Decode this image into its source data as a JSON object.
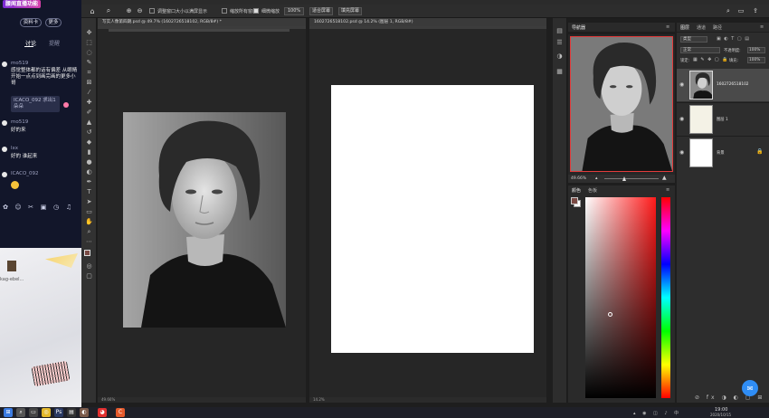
{
  "chat": {
    "banner": "腰闻直播功能",
    "buttons": [
      "资料卡",
      "更多"
    ],
    "tabs": [
      "讨论",
      "提醒"
    ],
    "messages": [
      {
        "name": "mo519",
        "text": "感觉整体都的话有偏差 从眼睛开始一点点到画完画的更多小哥"
      },
      {
        "name": "",
        "text": "ICACO_092 求出1朵朵"
      },
      {
        "name": "mo519",
        "text": "好的来"
      },
      {
        "name": "lxx",
        "text": "好的 谁起来"
      },
      {
        "name": "ICACO_092",
        "text": ""
      }
    ],
    "bottom_label": "kag-ebel..."
  },
  "options_bar": {
    "check1": "调整窗口大小以满屏显示",
    "check2": "缩放所有窗口",
    "check3": "细微缩放",
    "zoom": "100%",
    "btn1": "适合屏幕",
    "btn2": "填充屏幕"
  },
  "documents": [
    {
      "tab": "写实人像第四期.psd @ 49.7% (1602726518102, RGB/8#) *",
      "status": "49.66%"
    },
    {
      "tab": "1602726518102.psd @ 14.2% (图层 1, RGB/8#)",
      "status": "14.2%"
    }
  ],
  "navigator": {
    "tabs": [
      "导航器"
    ],
    "zoom": "49.66%"
  },
  "color_panel": {
    "tabs": [
      "颜色",
      "色板"
    ],
    "fg": "#7a4a44",
    "bg": "#ffffff"
  },
  "layers": {
    "tabs": [
      "图层",
      "通道",
      "路径"
    ],
    "kind": "类型",
    "blend": "正常",
    "opacity_label": "不透明度:",
    "opacity": "100%",
    "lock_label": "锁定:",
    "fill_label": "填充:",
    "fill": "100%",
    "items": [
      {
        "name": "1602726518102"
      },
      {
        "name": "图层 1"
      },
      {
        "name": "背景"
      }
    ]
  },
  "taskbar": {
    "time": "19:00",
    "date": "2020/10/15"
  }
}
